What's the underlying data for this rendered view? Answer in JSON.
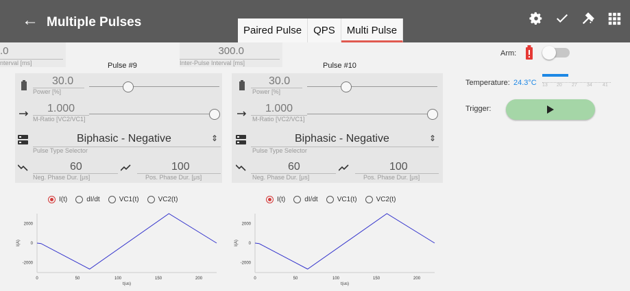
{
  "header": {
    "title": "Multiple Pulses",
    "back_label": "←"
  },
  "tabs": [
    {
      "label": "Paired Pulse"
    },
    {
      "label": "QPS"
    },
    {
      "label": "Multi Pulse"
    }
  ],
  "left_strip": {
    "interval_value": ".0",
    "interval_label": "nterval [ms]"
  },
  "inter_pulse": {
    "value": "300.0",
    "label": "Inter-Pulse Interval [ms]"
  },
  "pulse9": {
    "title": "Pulse #9",
    "power": {
      "value": "30.0",
      "label": "Power [%]",
      "level": 0.25
    },
    "mratio": {
      "value": "1.000",
      "label": "M-Ratio [VC2/VC1]",
      "level": 1
    },
    "type": {
      "value": "Biphasic - Negative",
      "label": "Pulse Type Selector"
    },
    "neg": {
      "value": "60",
      "label": "Neg. Phase Dur. [μs]"
    },
    "pos": {
      "value": "100",
      "label": "Pos. Phase Dur. [μs]"
    }
  },
  "pulse10": {
    "title": "Pulse #10",
    "power": {
      "value": "30.0",
      "label": "Power [%]",
      "level": 0.25
    },
    "mratio": {
      "value": "1.000",
      "label": "M-Ratio [VC2/VC1]",
      "level": 1
    },
    "type": {
      "value": "Biphasic - Negative",
      "label": "Pulse Type Selector"
    },
    "neg": {
      "value": "60",
      "label": "Neg. Phase Dur. [μs]"
    },
    "pos": {
      "value": "100",
      "label": "Pos. Phase Dur. [μs]"
    }
  },
  "radios": [
    "I(t)",
    "dI/dt",
    "VC1(t)",
    "VC2(t)"
  ],
  "right": {
    "arm_label": "Arm:",
    "temp_label": "Temperature:",
    "temp_value": "24.3°C",
    "temp_ticks": [
      "13",
      "20",
      "27",
      "34",
      "41"
    ],
    "trigger_label": "Trigger:"
  },
  "chart_data": [
    {
      "type": "line",
      "xlabel": "t(us)",
      "ylabel": "I(A)",
      "xticks": [
        "0",
        "50",
        "100",
        "150",
        "200"
      ],
      "yticks": [
        "2000",
        "0",
        "-2000"
      ],
      "x": [
        0,
        5,
        65,
        163,
        222
      ],
      "y": [
        0,
        -50,
        -2650,
        3000,
        0
      ],
      "xlim": [
        0,
        222
      ],
      "ylim": [
        -3000,
        3000
      ],
      "color": "#3333cc"
    },
    {
      "type": "line",
      "xlabel": "t(us)",
      "ylabel": "I(A)",
      "xticks": [
        "0",
        "50",
        "100",
        "150",
        "200"
      ],
      "yticks": [
        "2000",
        "0",
        "-2000"
      ],
      "x": [
        0,
        5,
        65,
        163,
        222
      ],
      "y": [
        0,
        -50,
        -2650,
        3000,
        0
      ],
      "xlim": [
        0,
        222
      ],
      "ylim": [
        -3000,
        3000
      ],
      "color": "#3333cc"
    }
  ]
}
